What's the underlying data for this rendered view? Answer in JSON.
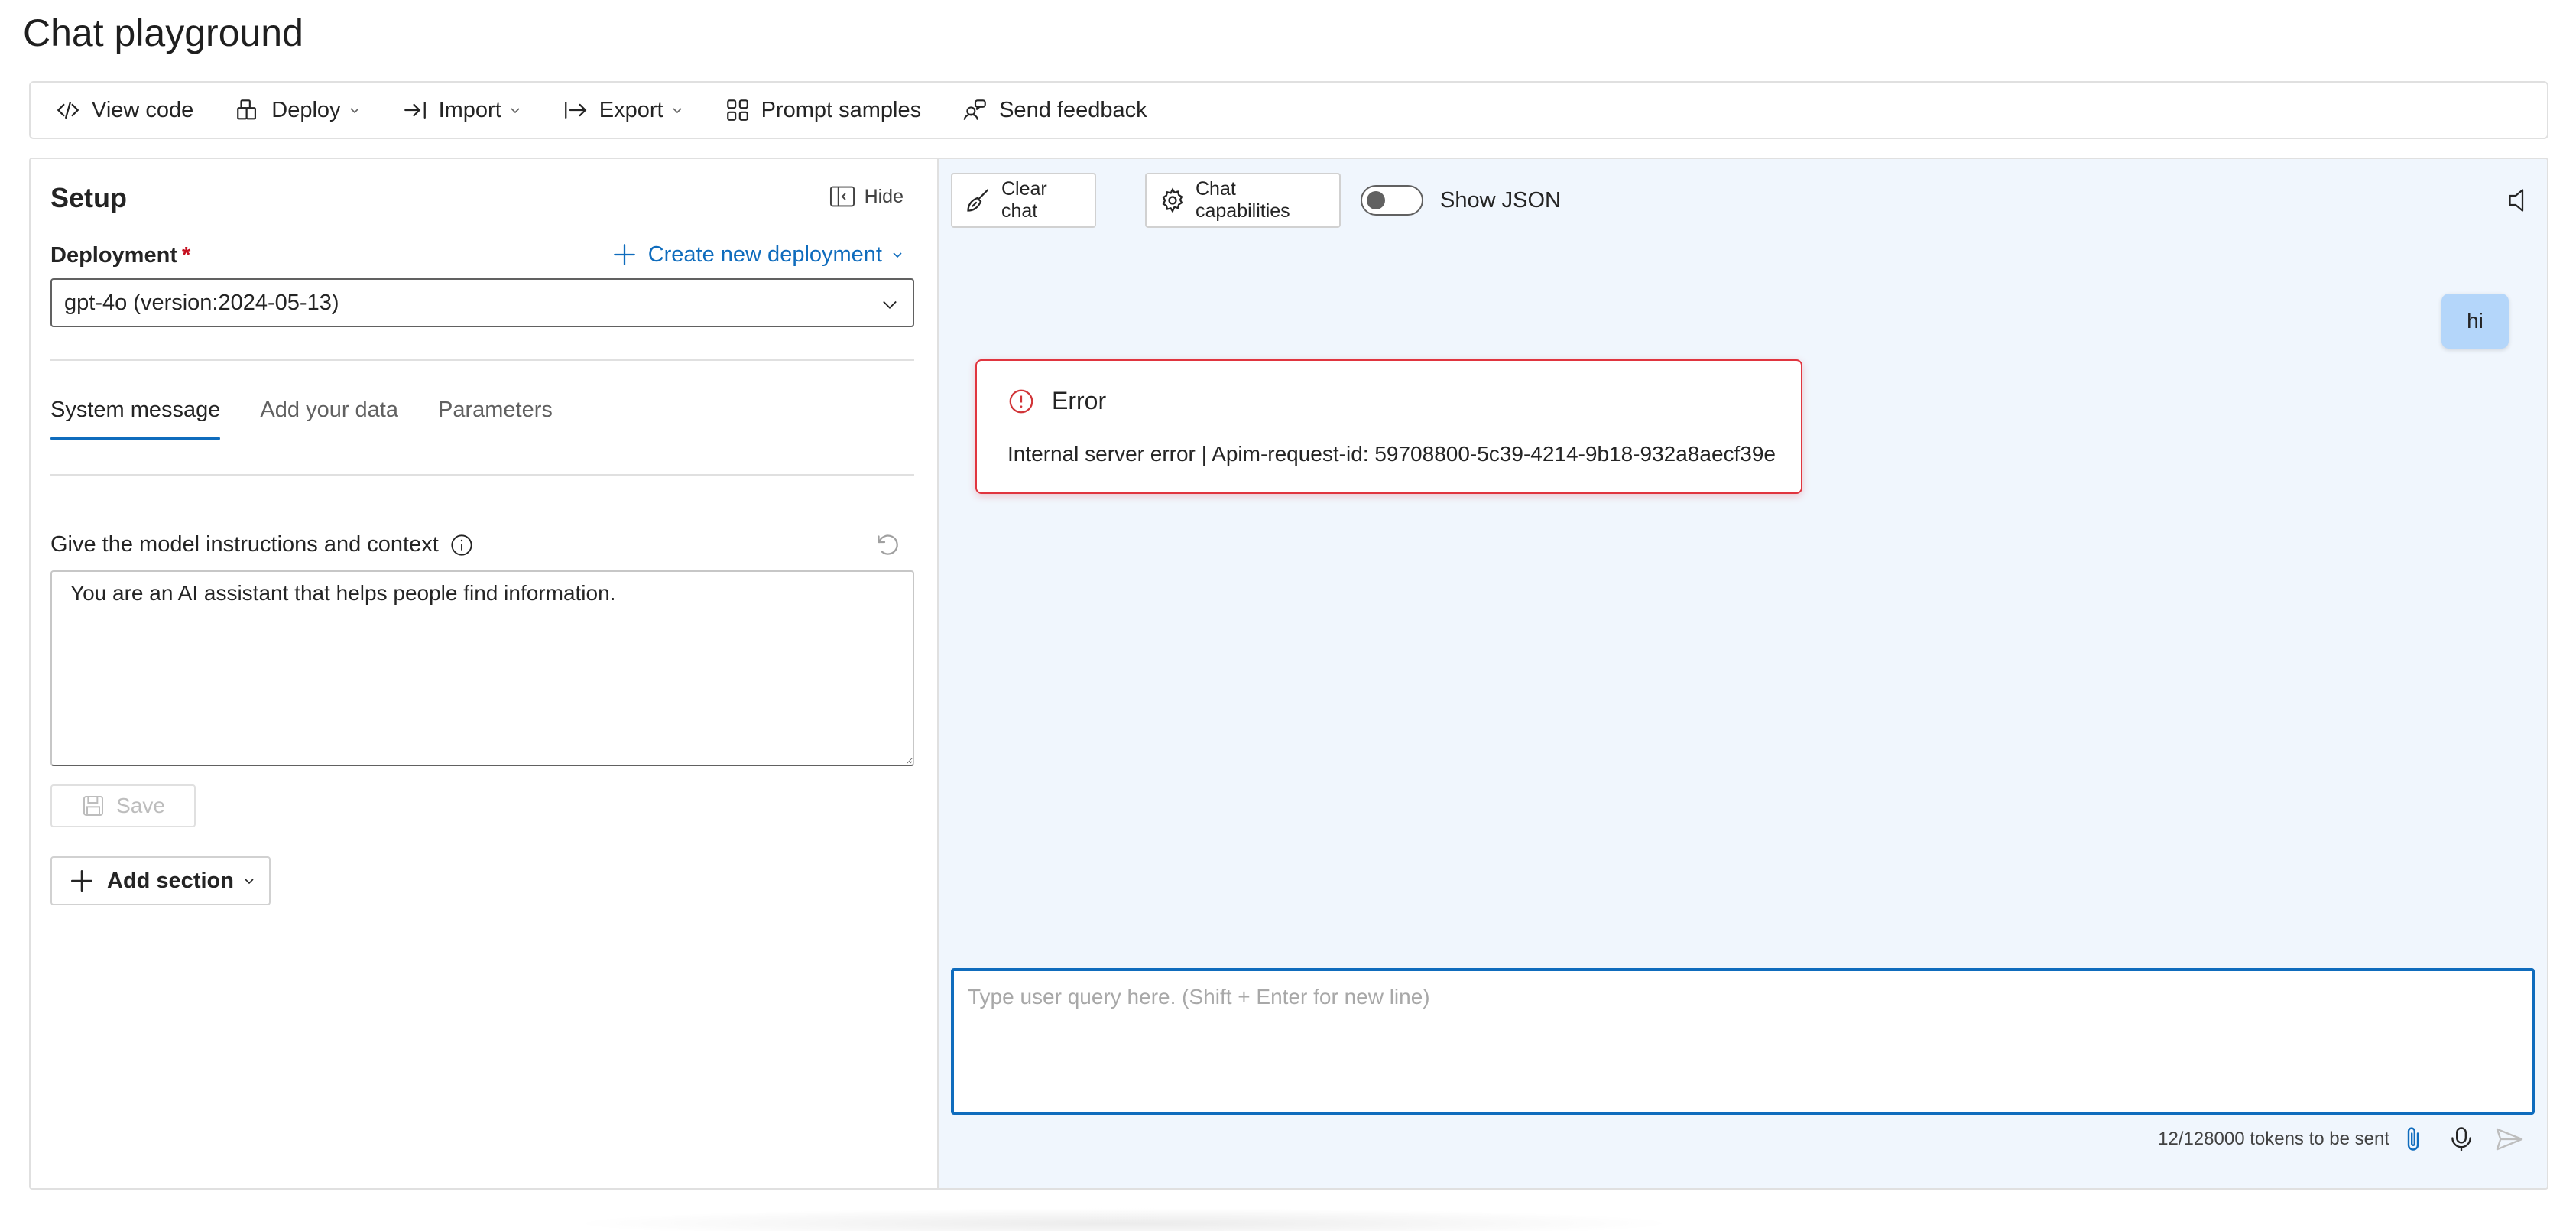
{
  "page": {
    "title": "Chat playground"
  },
  "toolbar": {
    "view_code": "View code",
    "deploy": "Deploy",
    "import": "Import",
    "export": "Export",
    "prompt_samples": "Prompt samples",
    "send_feedback": "Send feedback"
  },
  "setup": {
    "title": "Setup",
    "hide_label": "Hide",
    "deployment_label": "Deployment",
    "required_mark": "*",
    "create_deployment": "Create new deployment",
    "deployment_value": "gpt-4o (version:2024-05-13)",
    "tabs": [
      {
        "label": "System message",
        "active": true
      },
      {
        "label": "Add your data",
        "active": false
      },
      {
        "label": "Parameters",
        "active": false
      }
    ],
    "instructions_label": "Give the model instructions and context",
    "system_message": "You are an AI assistant that helps people find information.",
    "save_label": "Save",
    "add_section_label": "Add section"
  },
  "chat": {
    "clear_chat": "Clear chat",
    "chat_capabilities": "Chat capabilities",
    "show_json": "Show JSON",
    "show_json_on": false,
    "user_message": "hi",
    "error": {
      "title": "Error",
      "message": "Internal server error | Apim-request-id: 59708800-5c39-4214-9b18-932a8aecf39e"
    },
    "query_placeholder": "Type user query here. (Shift + Enter for new line)",
    "tokens_info": "12/128000 tokens to be sent"
  },
  "colors": {
    "accent": "#0f6cbd",
    "error": "#e0353f",
    "chat_bg": "#f0f6fd",
    "user_bubble": "#b4d6fa"
  },
  "icons": {
    "view_code": "code-icon",
    "deploy": "cube-icon",
    "import": "arrow-import-icon",
    "export": "arrow-export-icon",
    "prompt_samples": "grid-icon",
    "send_feedback": "person-feedback-icon",
    "hide": "panel-hide-icon",
    "create": "plus-icon",
    "info": "info-icon",
    "reset": "undo-icon",
    "save": "save-icon",
    "add_section": "plus-icon",
    "clear_chat": "broom-icon",
    "chat_capabilities": "gear-icon",
    "speaker": "speaker-icon",
    "error": "error-circle-icon",
    "attach": "paperclip-icon",
    "mic": "microphone-icon",
    "send": "send-icon"
  }
}
